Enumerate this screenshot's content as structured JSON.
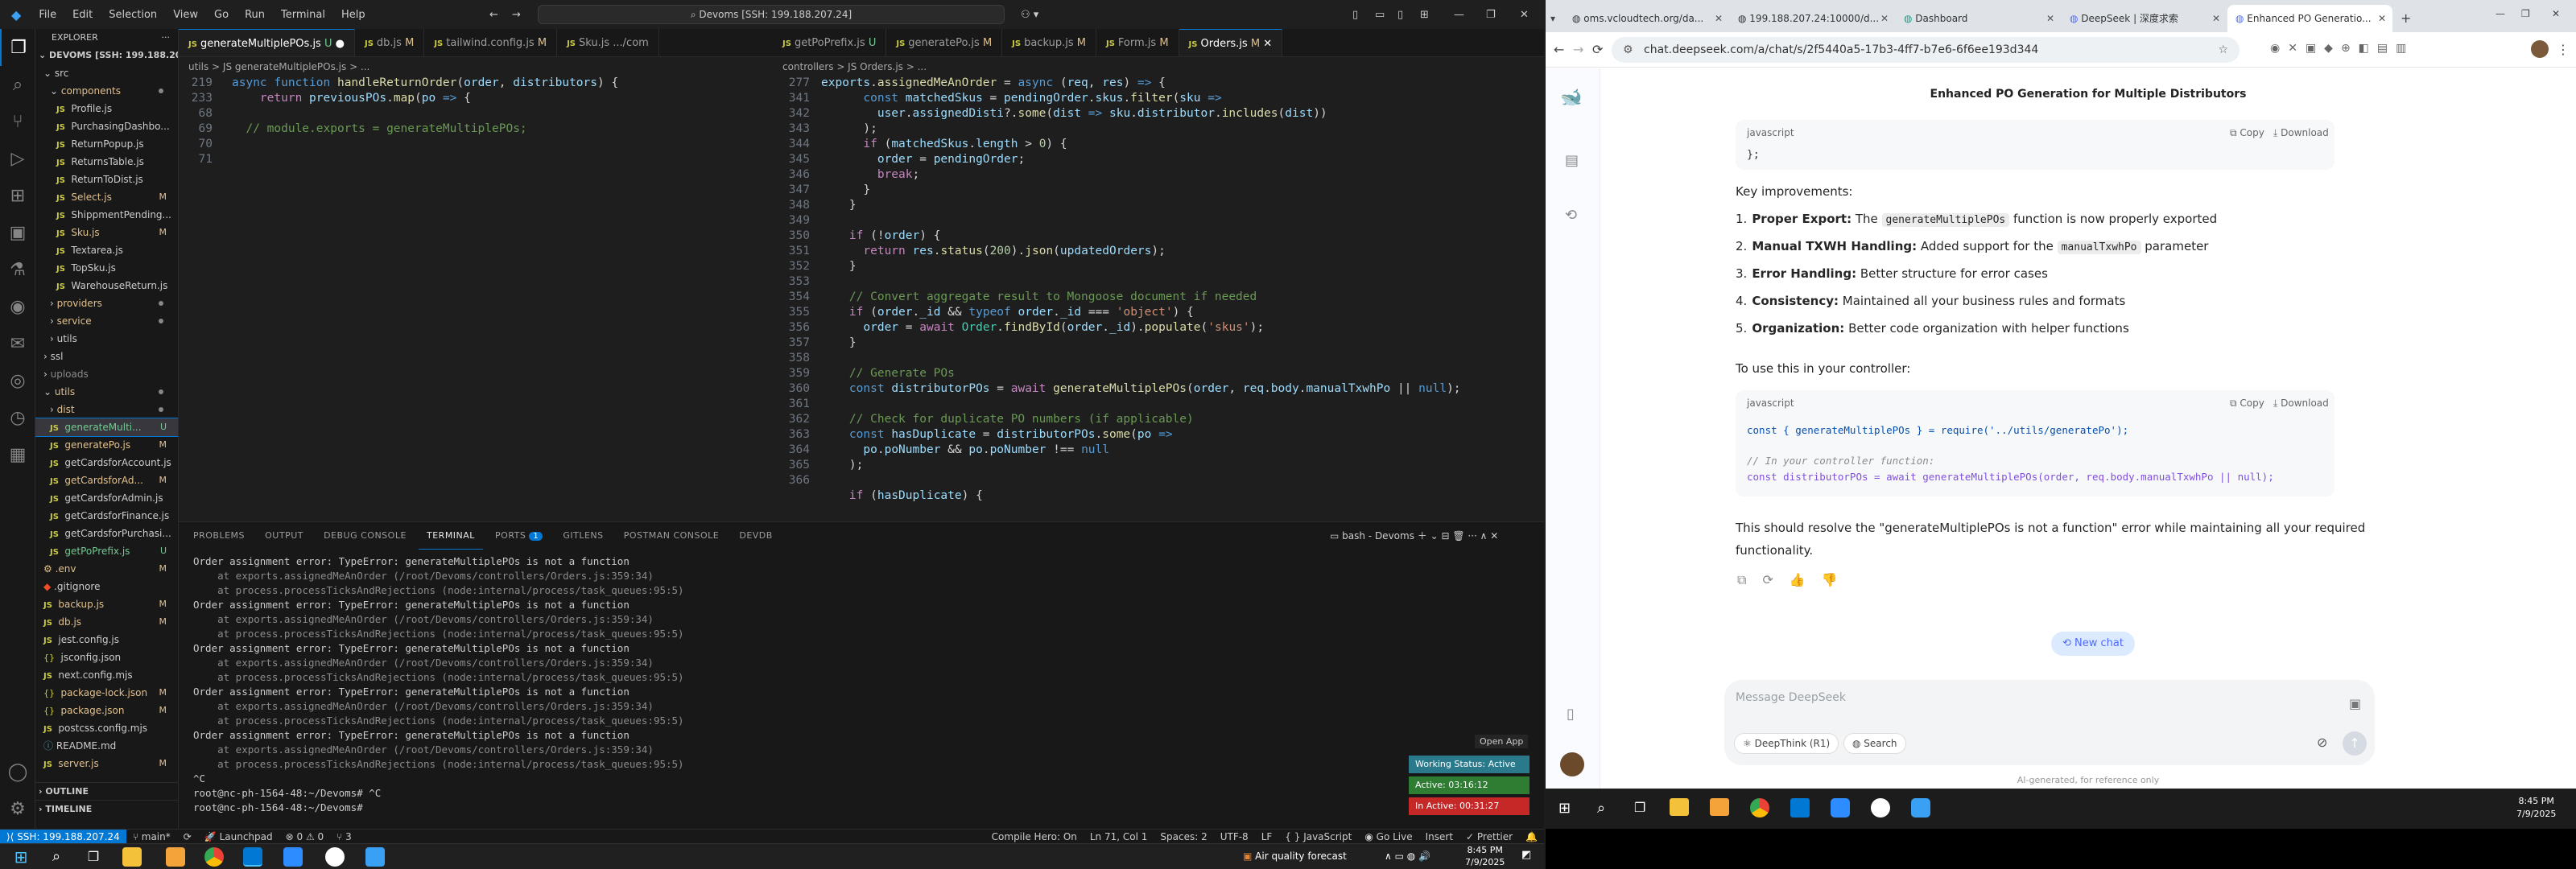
{
  "vscode": {
    "menu": [
      "File",
      "Edit",
      "Selection",
      "View",
      "Go",
      "Run",
      "Terminal",
      "Help"
    ],
    "command_center": "Devoms [SSH: 199.188.207.24]",
    "explorer_title": "EXPLORER",
    "workspace": "DEVOMS [SSH: 199.188.20...",
    "tree": [
      {
        "label": "src",
        "indent": 1,
        "type": "folder-open"
      },
      {
        "label": "components",
        "indent": 2,
        "type": "folder-open",
        "state": "mod"
      },
      {
        "label": "Profile.js",
        "indent": 3,
        "type": "js"
      },
      {
        "label": "PurchasingDashbo...",
        "indent": 3,
        "type": "js"
      },
      {
        "label": "ReturnPopup.js",
        "indent": 3,
        "type": "js"
      },
      {
        "label": "ReturnsTable.js",
        "indent": 3,
        "type": "js"
      },
      {
        "label": "ReturnToDist.js",
        "indent": 3,
        "type": "js"
      },
      {
        "label": "Select.js",
        "indent": 3,
        "type": "js",
        "badge": "M",
        "state": "mod"
      },
      {
        "label": "ShippmentPending...",
        "indent": 3,
        "type": "js"
      },
      {
        "label": "Sku.js",
        "indent": 3,
        "type": "js",
        "badge": "M",
        "state": "mod"
      },
      {
        "label": "Textarea.js",
        "indent": 3,
        "type": "js"
      },
      {
        "label": "TopSku.js",
        "indent": 3,
        "type": "js"
      },
      {
        "label": "WarehouseReturn.js",
        "indent": 3,
        "type": "js"
      },
      {
        "label": "providers",
        "indent": 2,
        "type": "folder",
        "state": "mod"
      },
      {
        "label": "service",
        "indent": 2,
        "type": "folder",
        "state": "mod"
      },
      {
        "label": "utils",
        "indent": 2,
        "type": "folder"
      },
      {
        "label": "ssl",
        "indent": 1,
        "type": "folder"
      },
      {
        "label": "uploads",
        "indent": 1,
        "type": "folder",
        "state": "dim"
      },
      {
        "label": "utils",
        "indent": 1,
        "type": "folder-open",
        "state": "mod"
      },
      {
        "label": "dist",
        "indent": 2,
        "type": "folder",
        "state": "mod"
      },
      {
        "label": "generateMulti...",
        "indent": 2,
        "type": "js",
        "badge": "U",
        "state": "untr",
        "selected": true
      },
      {
        "label": "generatePo.js",
        "indent": 2,
        "type": "js",
        "badge": "M",
        "state": "mod"
      },
      {
        "label": "getCardsforAccount.js",
        "indent": 2,
        "type": "js"
      },
      {
        "label": "getCardsforAd...",
        "indent": 2,
        "type": "js",
        "badge": "M",
        "state": "mod"
      },
      {
        "label": "getCardsforAdmin.js",
        "indent": 2,
        "type": "js"
      },
      {
        "label": "getCardsforFinance.js",
        "indent": 2,
        "type": "js"
      },
      {
        "label": "getCardsforPurchasi...",
        "indent": 2,
        "type": "js"
      },
      {
        "label": "getPoPrefix.js",
        "indent": 2,
        "type": "js",
        "badge": "U",
        "state": "untr"
      },
      {
        "label": ".env",
        "indent": 1,
        "type": "env",
        "badge": "M",
        "state": "mod"
      },
      {
        "label": ".gitignore",
        "indent": 1,
        "type": "git"
      },
      {
        "label": "backup.js",
        "indent": 1,
        "type": "js",
        "badge": "M",
        "state": "mod"
      },
      {
        "label": "db.js",
        "indent": 1,
        "type": "js",
        "badge": "M",
        "state": "mod"
      },
      {
        "label": "jest.config.js",
        "indent": 1,
        "type": "js"
      },
      {
        "label": "jsconfig.json",
        "indent": 1,
        "type": "json"
      },
      {
        "label": "next.config.mjs",
        "indent": 1,
        "type": "js"
      },
      {
        "label": "package-lock.json",
        "indent": 1,
        "type": "json",
        "badge": "M",
        "state": "mod"
      },
      {
        "label": "package.json",
        "indent": 1,
        "type": "json",
        "badge": "M",
        "state": "mod"
      },
      {
        "label": "postcss.config.mjs",
        "indent": 1,
        "type": "js"
      },
      {
        "label": "README.md",
        "indent": 1,
        "type": "md"
      },
      {
        "label": "server.js",
        "indent": 1,
        "type": "js",
        "badge": "M",
        "state": "mod"
      }
    ],
    "outline": "OUTLINE",
    "timeline": "TIMELINE",
    "left_tabs": [
      {
        "label": "generateMultiplePOs.js",
        "badge": "U",
        "active": true
      },
      {
        "label": "db.js",
        "badge": "M"
      },
      {
        "label": "tailwind.config.js",
        "badge": "M"
      },
      {
        "label": "Sku.js",
        "badge": ".../com"
      }
    ],
    "right_tabs": [
      {
        "label": "getPoPrefix.js",
        "badge": "U"
      },
      {
        "label": "generatePo.js",
        "badge": "M"
      },
      {
        "label": "backup.js",
        "badge": "M"
      },
      {
        "label": "Form.js",
        "badge": "M"
      },
      {
        "label": "Orders.js",
        "badge": "M",
        "active": true
      }
    ],
    "left_breadcrumb": "utils > JS generateMultiplePOs.js > ...",
    "right_breadcrumb": "controllers > JS Orders.js > ...",
    "left_line_numbers": [
      "219",
      "233",
      "68",
      "69",
      "70",
      "71"
    ],
    "right_line_numbers": [
      "277",
      "341",
      "342",
      "343",
      "344",
      "345",
      "346",
      "347",
      "348",
      "349",
      "350",
      "351",
      "352",
      "353",
      "354",
      "355",
      "356",
      "357",
      "358",
      "359",
      "360",
      "361",
      "362",
      "363",
      "364",
      "365",
      "366"
    ],
    "panel_tabs": [
      "PROBLEMS",
      "OUTPUT",
      "DEBUG CONSOLE",
      "TERMINAL",
      "PORTS",
      "GITLENS",
      "POSTMAN CONSOLE",
      "DEVDB"
    ],
    "ports_count": "1",
    "terminal_name": "bash - Devoms",
    "terminal_lines": [
      "Order assignment error: TypeError: generateMultiplePOs is not a function",
      "    at exports.assignedMeAnOrder (/root/Devoms/controllers/Orders.js:359:34)",
      "    at process.processTicksAndRejections (node:internal/process/task_queues:95:5)",
      "Order assignment error: TypeError: generateMultiplePOs is not a function",
      "    at exports.assignedMeAnOrder (/root/Devoms/controllers/Orders.js:359:34)",
      "    at process.processTicksAndRejections (node:internal/process/task_queues:95:5)",
      "Order assignment error: TypeError: generateMultiplePOs is not a function",
      "    at exports.assignedMeAnOrder (/root/Devoms/controllers/Orders.js:359:34)",
      "    at process.processTicksAndRejections (node:internal/process/task_queues:95:5)",
      "Order assignment error: TypeError: generateMultiplePOs is not a function",
      "    at exports.assignedMeAnOrder (/root/Devoms/controllers/Orders.js:359:34)",
      "    at process.processTicksAndRejections (node:internal/process/task_queues:95:5)",
      "Order assignment error: TypeError: generateMultiplePOs is not a function",
      "    at exports.assignedMeAnOrder (/root/Devoms/controllers/Orders.js:359:34)",
      "    at process.processTicksAndRejections (node:internal/process/task_queues:95:5)",
      "^C",
      "root@nc-ph-1564-48:~/Devoms# ^C",
      "root@nc-ph-1564-48:~/Devoms# "
    ],
    "open_app": "Open App",
    "working_status": "Working Status: Active",
    "active_time": "Active: 03:16:12",
    "inactive_time": "In Active: 00:31:27",
    "status": {
      "remote": "SSH: 199.188.207.24",
      "branch": "main*",
      "launchpad": "Launchpad",
      "errors": "0",
      "warnings": "0",
      "ports": "3",
      "compile_hero": "Compile Hero: On",
      "position": "Ln 71, Col 1",
      "spaces": "Spaces: 2",
      "encoding": "UTF-8",
      "eol": "LF",
      "language": "JavaScript",
      "golive": "Go Live",
      "insert": "Insert",
      "prettier": "Prettier"
    }
  },
  "taskbar_left": {
    "weather": "Air quality forecast",
    "time": "8:45 PM",
    "date": "7/9/2025"
  },
  "chrome": {
    "tabs": [
      {
        "label": "oms.vcloudtech.org/da..."
      },
      {
        "label": "199.188.207.24:10000/d..."
      },
      {
        "label": "Dashboard"
      },
      {
        "label": "DeepSeek | 深度求索"
      },
      {
        "label": "Enhanced PO Generatio...",
        "active": true
      }
    ],
    "url": "chat.deepseek.com/a/chat/s/2f5440a5-17b3-4ff7-b7e6-6f6ee193d344",
    "chat_title": "Enhanced PO Generation for Multiple Distributors",
    "code1_lang": "javascript",
    "copy": "Copy",
    "download": "Download",
    "code1_line": "};",
    "key_improvements": "Key improvements:",
    "improvements": [
      {
        "num": "1.",
        "bold": "Proper Export:",
        "pre": " The ",
        "code": "generateMultiplePOs",
        "post": " function is now properly exported"
      },
      {
        "num": "2.",
        "bold": "Manual TXWH Handling:",
        "pre": " Added support for the ",
        "code": "manualTxwhPo",
        "post": " parameter"
      },
      {
        "num": "3.",
        "bold": "Error Handling:",
        "pre": " Better structure for error cases",
        "code": "",
        "post": ""
      },
      {
        "num": "4.",
        "bold": "Consistency:",
        "pre": " Maintained all your business rules and formats",
        "code": "",
        "post": ""
      },
      {
        "num": "5.",
        "bold": "Organization:",
        "pre": " Better code organization with helper functions",
        "code": "",
        "post": ""
      }
    ],
    "use_text": "To use this in your controller:",
    "code2_lang": "javascript",
    "code2_line1": "const { generateMultiplePOs } = require('../utils/generatePo');",
    "code2_comment": "// In your controller function:",
    "code2_line3": "const distributorPOs = await generateMultiplePOs(order, req.body.manualTxwhPo || null);",
    "resolve_text_1": "This should resolve the \"generateMultiplePOs is not a function\" error while maintaining all your required",
    "resolve_text_2": "functionality.",
    "new_chat": "New chat",
    "input_placeholder": "Message DeepSeek",
    "deepthink": "DeepThink (R1)",
    "search": "Search",
    "disclaimer": "AI-generated, for reference only",
    "clock_time": "8:45 PM",
    "clock_date": "7/9/2025"
  }
}
